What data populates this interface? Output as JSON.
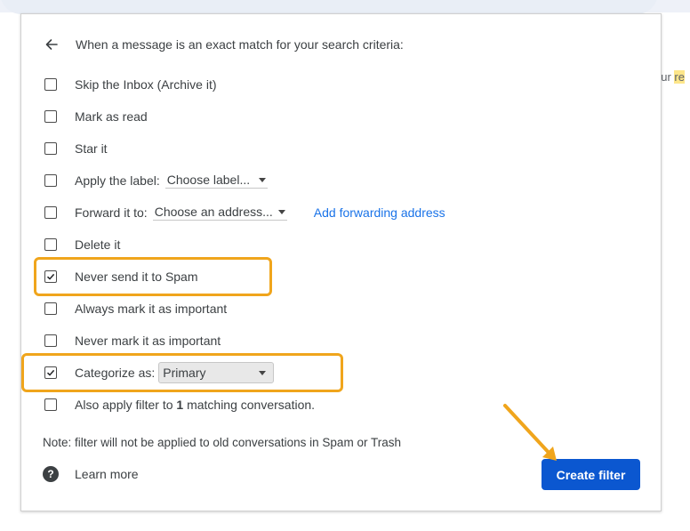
{
  "background": {
    "partial_text_prefix": "our ",
    "partial_text_highlight": "re"
  },
  "dialog": {
    "header": "When a message is an exact match for your search criteria:",
    "options": [
      {
        "label": "Skip the Inbox (Archive it)",
        "checked": false
      },
      {
        "label": "Mark as read",
        "checked": false
      },
      {
        "label": "Star it",
        "checked": false
      },
      {
        "label": "Apply the label:",
        "checked": false,
        "select_value": "Choose label..."
      },
      {
        "label": "Forward it to:",
        "checked": false,
        "select_value": "Choose an address...",
        "link": "Add forwarding address"
      },
      {
        "label": "Delete it",
        "checked": false
      },
      {
        "label": "Never send it to Spam",
        "checked": true
      },
      {
        "label": "Always mark it as important",
        "checked": false
      },
      {
        "label": "Never mark it as important",
        "checked": false
      },
      {
        "label": "Categorize as:",
        "checked": true,
        "select_value": "Primary"
      },
      {
        "label_prefix": "Also apply filter to ",
        "label_bold": "1",
        "label_suffix": " matching conversation.",
        "checked": false
      }
    ],
    "note": "Note: filter will not be applied to old conversations in Spam or Trash",
    "learn_more": "Learn more",
    "help_icon_glyph": "?",
    "create_button": "Create filter"
  },
  "colors": {
    "accent_button": "#0b57d0",
    "link": "#1a73e8",
    "annotation": "#f0a51c"
  }
}
